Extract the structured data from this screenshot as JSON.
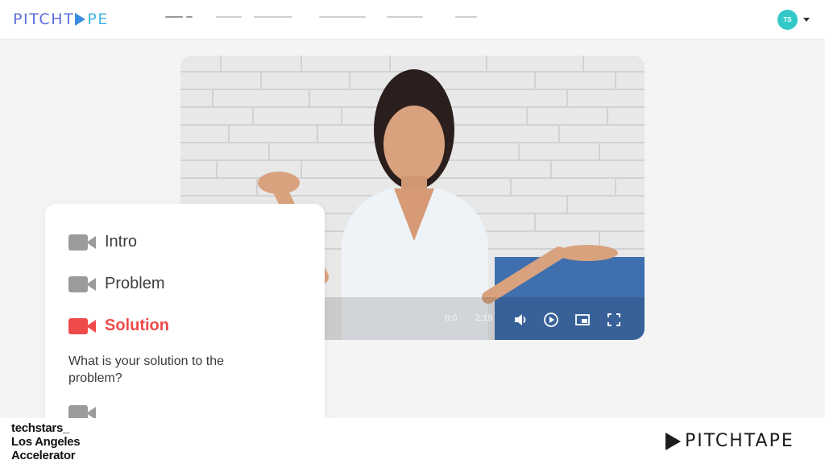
{
  "brand": {
    "logo_part1": "PITCHT",
    "logo_part2": "PE"
  },
  "user": {
    "initials": "TS"
  },
  "player": {
    "elapsed": "0:0",
    "duration": "2:19"
  },
  "sections": [
    {
      "label": "Intro",
      "state": "done"
    },
    {
      "label": "Problem",
      "state": "done"
    },
    {
      "label": "Solution",
      "state": "current"
    }
  ],
  "prompt": {
    "question": "What is your solution to the problem?"
  },
  "footer": {
    "partner_line1": "techstars_",
    "partner_line2": "Los Angeles",
    "partner_line3": "Accelerator",
    "logo_text": "PITCHTAPE"
  },
  "colors": {
    "accent_red": "#ef4b4b",
    "avatar_teal": "#33c9c9",
    "logo_blue": "#5b6fdc"
  }
}
